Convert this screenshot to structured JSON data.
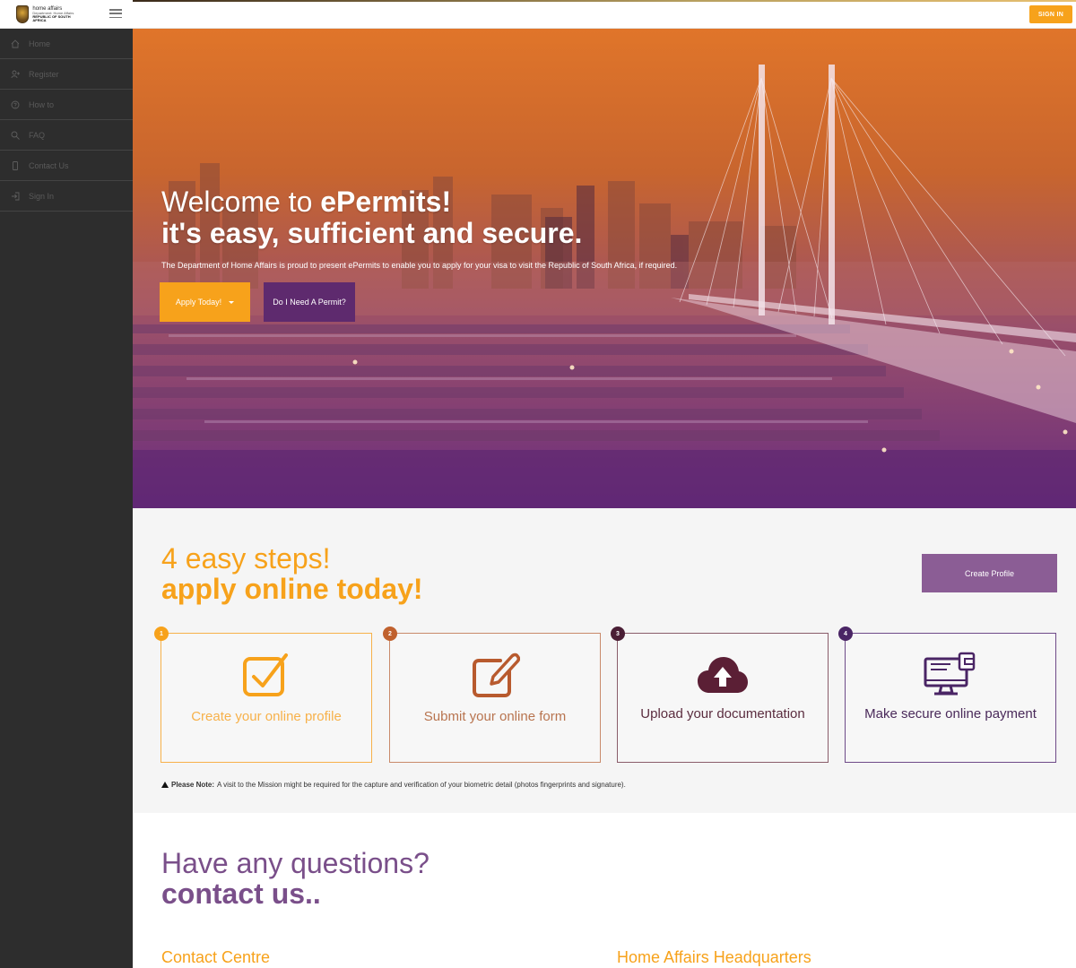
{
  "header": {
    "logo": {
      "line1": "home affairs",
      "line2": "Department: Home Affairs",
      "line3": "REPUBLIC OF SOUTH AFRICA"
    },
    "sign_in_label": "SIGN IN"
  },
  "sidebar": {
    "items": [
      {
        "label": "Home",
        "icon": "home-icon"
      },
      {
        "label": "Register",
        "icon": "register-icon"
      },
      {
        "label": "How to",
        "icon": "help-icon"
      },
      {
        "label": "FAQ",
        "icon": "search-icon"
      },
      {
        "label": "Contact Us",
        "icon": "phone-icon"
      },
      {
        "label": "Sign In",
        "icon": "sign-in-icon"
      }
    ]
  },
  "hero": {
    "title_prefix": "Welcome to ",
    "title_bold": "ePermits!",
    "title_line2": "it's easy, sufficient and secure.",
    "description": "The Department of Home Affairs is proud to present ePermits to enable you to apply for your visa to visit the Republic of South Africa, if required.",
    "apply_button": "Apply Today!",
    "permit_button": "Do I Need A Permit?"
  },
  "steps": {
    "heading1": "4 easy steps!",
    "heading2": "apply online today!",
    "create_profile_button": "Create Profile",
    "cards": [
      {
        "number": "1",
        "text": "Create your online profile",
        "icon": "checkbox-icon"
      },
      {
        "number": "2",
        "text": "Submit your online form",
        "icon": "edit-form-icon"
      },
      {
        "number": "3",
        "text": "Upload your documentation",
        "icon": "cloud-upload-icon"
      },
      {
        "number": "4",
        "text": "Make secure online payment",
        "icon": "payment-monitor-icon"
      }
    ],
    "note_label": "Please Note:",
    "note_text": " A visit to the Mission might be required for the capture and verification of your biometric detail (photos fingerprints and signature)."
  },
  "contact": {
    "heading1": "Have any questions?",
    "heading2": "contact us..",
    "centre_title": "Contact Centre",
    "hq_title": "Home Affairs Headquarters"
  },
  "colors": {
    "accent_orange": "#f7a21b",
    "accent_purple": "#7a4f8a",
    "sidebar_bg": "#2d2d2d"
  }
}
